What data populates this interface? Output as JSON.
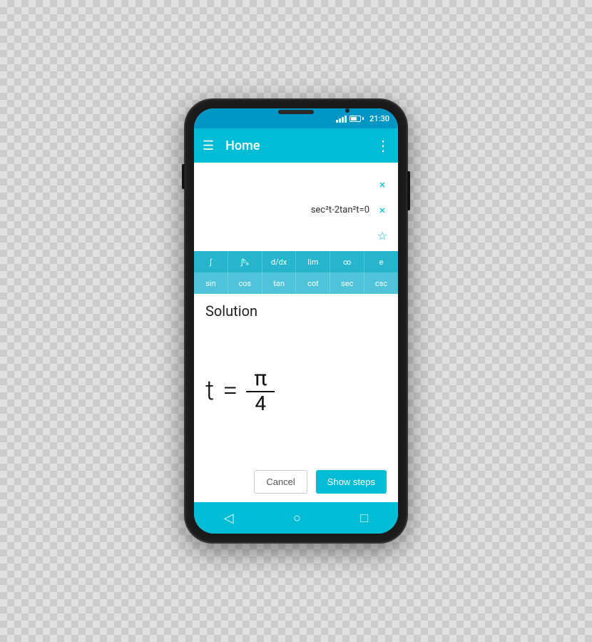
{
  "status_bar": {
    "time": "21:30"
  },
  "app_bar": {
    "title": "Home",
    "hamburger_label": "☰",
    "more_label": "⋮"
  },
  "expression": {
    "formula": "sec²t-2tan²t=0",
    "close_icon": "×",
    "close_icon2": "×",
    "star_icon": "☆"
  },
  "keyboard": {
    "row1": [
      "∫",
      "∫ᵇₐ",
      "d/dx",
      "lim",
      "∞",
      "e"
    ],
    "row2": [
      "sin",
      "cos",
      "tan",
      "cot",
      "sec",
      "csc"
    ]
  },
  "solution": {
    "label": "Solution",
    "variable": "t",
    "equals": "=",
    "numerator": "π",
    "denominator": "4"
  },
  "buttons": {
    "cancel": "Cancel",
    "show_steps": "Show steps"
  },
  "nav": {
    "back": "◁",
    "home": "○",
    "recent": "□"
  },
  "colors": {
    "primary": "#00bcd4",
    "status_bar": "#0097c4"
  }
}
